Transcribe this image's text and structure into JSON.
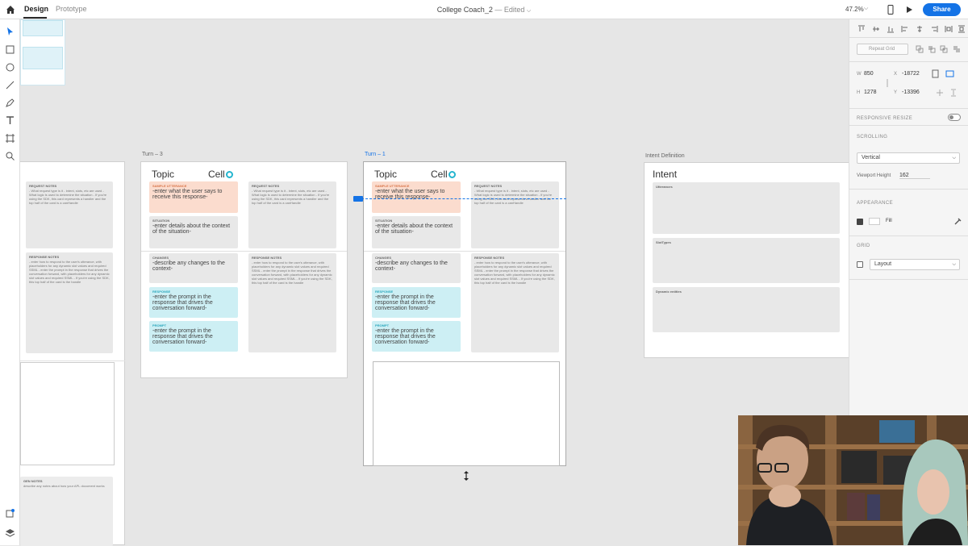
{
  "topbar": {
    "tabs": [
      "Design",
      "Prototype"
    ],
    "title": "College Coach_2",
    "status": "— Edited",
    "zoom": "47.2%",
    "share_label": "Share"
  },
  "right_panel": {
    "repeat_grid": "Repeat Grid",
    "w_label": "W",
    "w_value": "850",
    "x_label": "X",
    "x_value": "-18722",
    "h_label": "H",
    "h_value": "1278",
    "y_label": "Y",
    "y_value": "-13396",
    "responsive_resize": "RESPONSIVE RESIZE",
    "scrolling": "SCROLLING",
    "scrolling_value": "Vertical",
    "viewport_label": "Viewport Height",
    "viewport_value": "162",
    "appearance": "APPEARANCE",
    "fill_label": "Fill",
    "grid": "GRID",
    "grid_value": "Layout"
  },
  "canvas": {
    "label_turn3": "Turn – 3",
    "label_turn1": "Turn – 1",
    "label_intent": "Intent Definition",
    "topic": "Topic",
    "cell": "Cell",
    "intent": "Intent",
    "sample_label": "SAMPLE UTTERANCE",
    "sample_text": "-enter what the user says to receive this response-",
    "situation_label": "SITUATION",
    "situation_text": "-enter details about the context of the situation-",
    "changes_label": "CHANGES",
    "changes_text": "-describe any changes to the context-",
    "response_label": "RESPONSE",
    "response_text": "-enter the prompt in the response that drives the conversation forward-",
    "prompt_label": "PROMPT",
    "prompt_text": "-enter the prompt in the response that drives the conversation forward-",
    "request_notes_label": "REQUEST NOTES",
    "request_notes_text": "- What request type is it - Intent, slots, etc are used - What logic is used to determine the situation - If you're using the SDK, this card represents a handler and the top half of the card is a canHandle",
    "response_notes_label": "RESPONSE NOTES",
    "response_notes_text": "- enter how to respond to the user's utterance, with placeholders for any dynamic slot values and required SSML - enter the prompt in the response that drives the conversation forward, with placeholders for any dynamic slot values and required SSML - If you're using the SDK, this top half of the card is the handle",
    "gen_notes_label": "GEN NOTES",
    "gen_notes_text": "describe any notes about how your APL document works",
    "utterances": "Utterances",
    "slot_types": "SlotTypes",
    "dynamic_entities": "Dynamic entities"
  }
}
